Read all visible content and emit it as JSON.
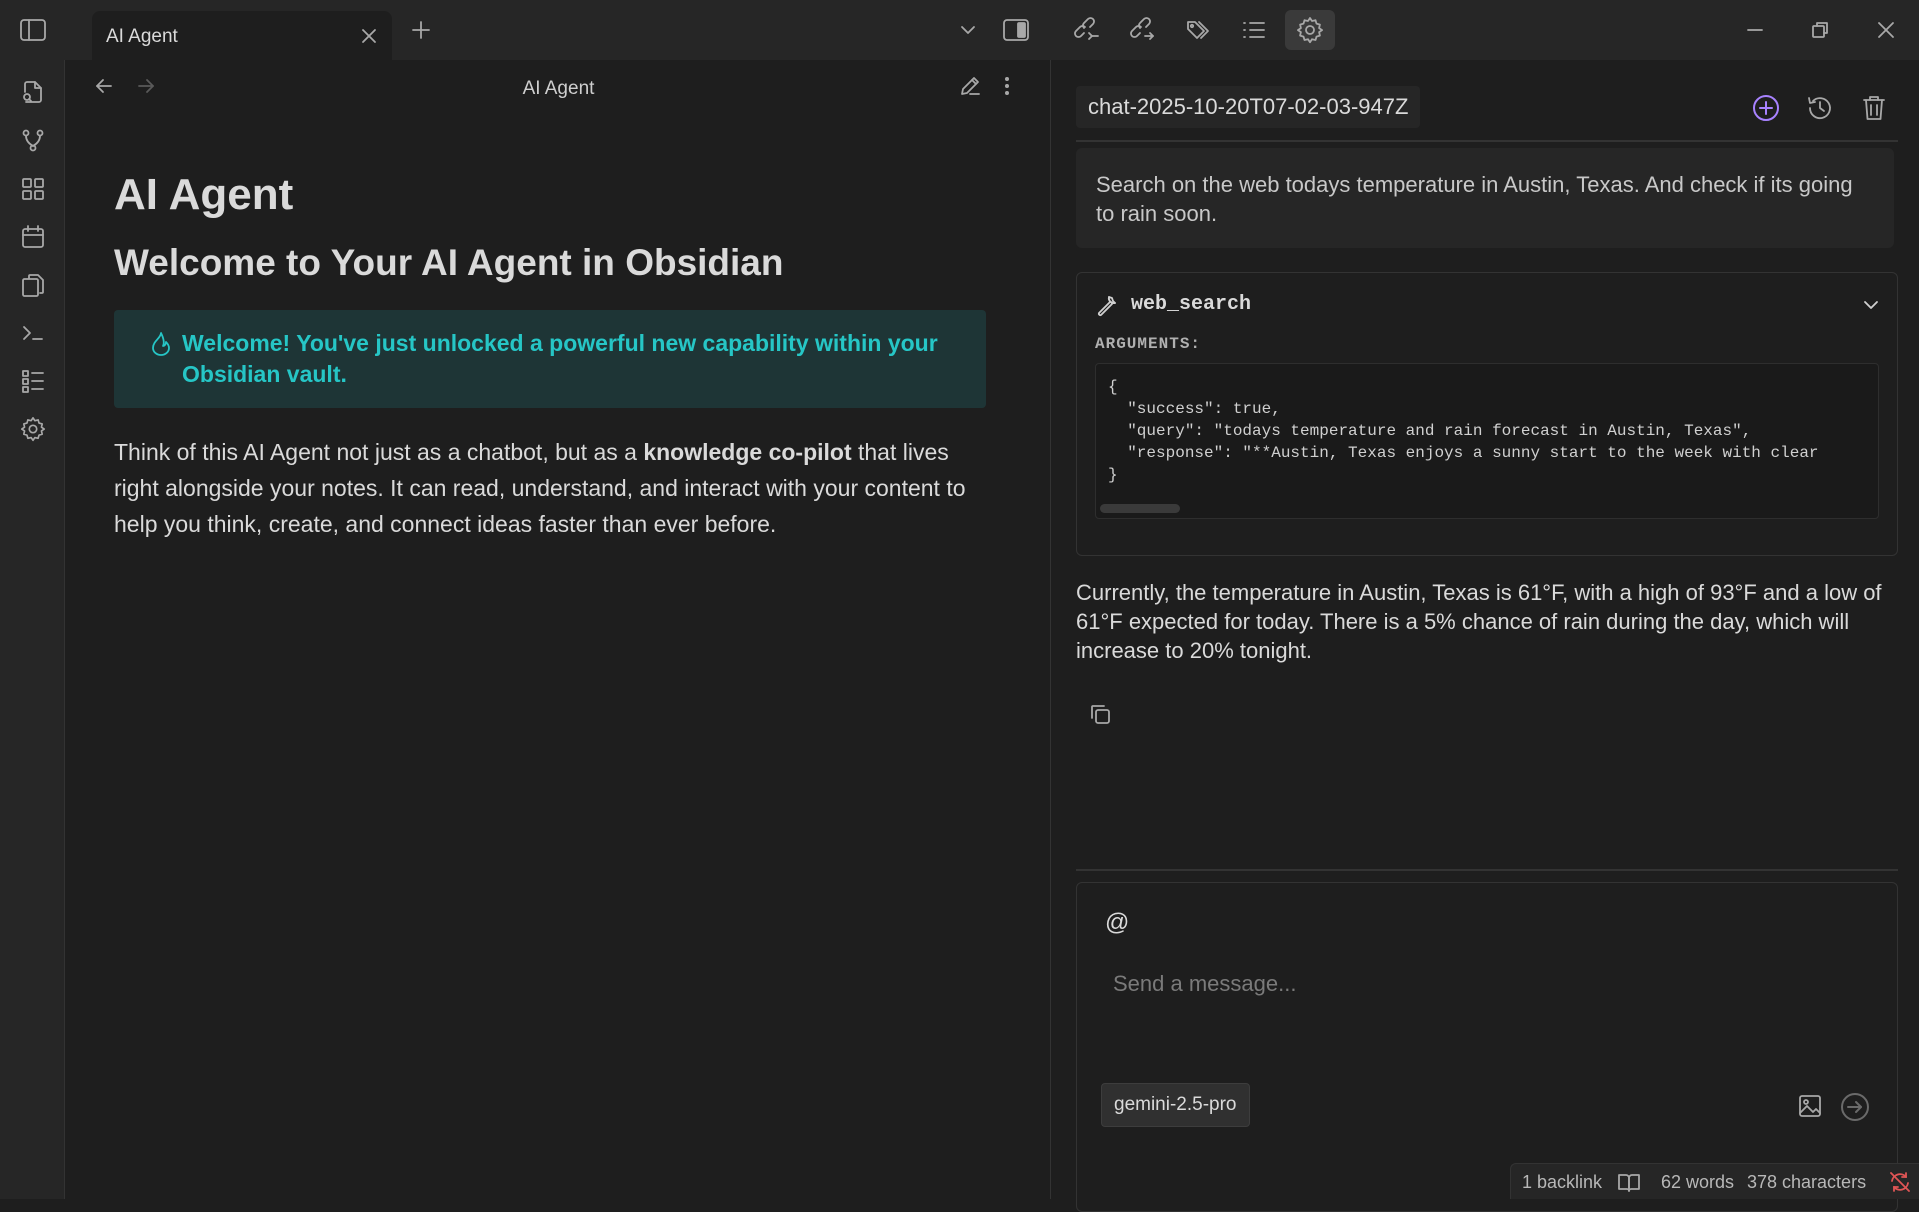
{
  "tab": {
    "title": "AI Agent"
  },
  "view": {
    "title": "AI Agent"
  },
  "note": {
    "title": "AI Agent",
    "heading": "Welcome to Your AI Agent in Obsidian",
    "callout": "Welcome! You've just unlocked a powerful new capability within your Obsidian vault.",
    "para_pre": "Think of this AI Agent not just as a chatbot, but as a ",
    "para_bold": "knowledge co-pilot",
    "para_post": " that lives right alongside your notes. It can read, understand, and interact with your content to help you think, create, and connect ideas faster than ever before."
  },
  "chat": {
    "title": "chat-2025-10-20T07-02-03-947Z",
    "user_message": "Search on the web todays temperature in Austin, Texas. And check if its going to rain soon.",
    "tool": {
      "name": "web_search",
      "args_label": "ARGUMENTS:",
      "code": "{\n  \"success\": true,\n  \"query\": \"todays temperature and rain forecast in Austin, Texas\",\n  \"response\": \"**Austin, Texas enjoys a sunny start to the week with clear\n}"
    },
    "answer": "Currently, the temperature in Austin, Texas is 61°F, with a high of 93°F and a low of 61°F expected for today. There is a 5% chance of rain during the day, which will increase to 20% tonight.",
    "composer": {
      "at": "@",
      "placeholder": "Send a message...",
      "model": "gemini-2.5-pro"
    }
  },
  "status": {
    "backlinks": "1 backlink",
    "words": "62 words",
    "chars": "378 characters"
  },
  "colors": {
    "accent": "#a882ff",
    "callout_text": "#26c6c6",
    "callout_bg": "#1e3536"
  }
}
